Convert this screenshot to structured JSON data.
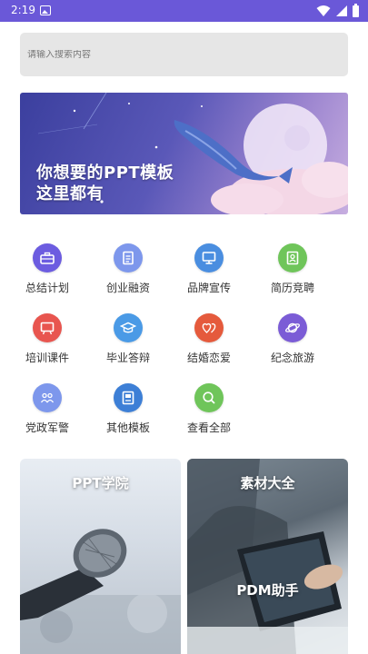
{
  "status_bar": {
    "time": "2:19",
    "color": "#6a58d8",
    "icons": [
      "photo-icon",
      "wifi-icon",
      "signal-icon",
      "battery-icon"
    ]
  },
  "search": {
    "placeholder": "请输入搜索内容",
    "value": ""
  },
  "banner": {
    "line1": "你想要的PPT模板",
    "line2": "这里都有"
  },
  "categories": [
    {
      "label": "总结计划",
      "icon": "briefcase-icon",
      "color": "#6c5ce0"
    },
    {
      "label": "创业融资",
      "icon": "document-icon",
      "color": "#7d97ec"
    },
    {
      "label": "品牌宣传",
      "icon": "computer-icon",
      "color": "#4a8ee0"
    },
    {
      "label": "简历竞聘",
      "icon": "resume-icon",
      "color": "#6fc55a"
    },
    {
      "label": "培训课件",
      "icon": "training-board-icon",
      "color": "#e8554f"
    },
    {
      "label": "毕业答辩",
      "icon": "graduation-cap-icon",
      "color": "#4a9ae6"
    },
    {
      "label": "结婚恋爱",
      "icon": "hearts-icon",
      "color": "#e55a3c"
    },
    {
      "label": "纪念旅游",
      "icon": "planet-icon",
      "color": "#7b5cd6"
    },
    {
      "label": "党政军警",
      "icon": "people-icon",
      "color": "#7d97ec"
    },
    {
      "label": "其他模板",
      "icon": "template-icon",
      "color": "#3d7fd6"
    },
    {
      "label": "查看全部",
      "icon": "search-all-icon",
      "color": "#6fc55a"
    }
  ],
  "cards": [
    {
      "title": "PPT学院",
      "subtitle": ""
    },
    {
      "title": "素材大全",
      "subtitle": "PDM助手"
    }
  ]
}
